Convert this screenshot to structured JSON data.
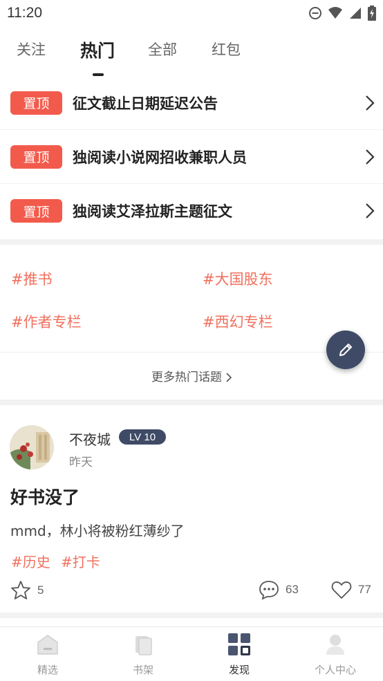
{
  "status_bar": {
    "time": "11:20"
  },
  "tabs": [
    {
      "label": "关注",
      "active": false
    },
    {
      "label": "热门",
      "active": true
    },
    {
      "label": "全部",
      "active": false
    },
    {
      "label": "红包",
      "active": false
    }
  ],
  "pinned": [
    {
      "badge": "置顶",
      "title": "征文截止日期延迟公告"
    },
    {
      "badge": "置顶",
      "title": "独阅读小说网招收兼职人员"
    },
    {
      "badge": "置顶",
      "title": "独阅读艾泽拉斯主题征文"
    }
  ],
  "topics": [
    "#推书",
    "#大国股东",
    "#作者专栏",
    "#西幻专栏"
  ],
  "more_topics": "更多热门话题",
  "post": {
    "author": "不夜城",
    "level": "LV 10",
    "time": "昨天",
    "title": "好书没了",
    "body": "mmd，林小将被粉红薄纱了",
    "tags": [
      "#历史",
      "#打卡"
    ],
    "favorites": "5",
    "comments": "63",
    "likes": "77"
  },
  "bottom_nav": [
    {
      "label": "精选",
      "icon": "home-icon",
      "active": false
    },
    {
      "label": "书架",
      "icon": "bookshelf-icon",
      "active": false
    },
    {
      "label": "发现",
      "icon": "discover-grid-icon",
      "active": true
    },
    {
      "label": "个人中心",
      "icon": "profile-icon",
      "active": false
    }
  ],
  "colors": {
    "accent": "#f25b4c",
    "tag": "#f0705e",
    "dark": "#3f4b66"
  }
}
